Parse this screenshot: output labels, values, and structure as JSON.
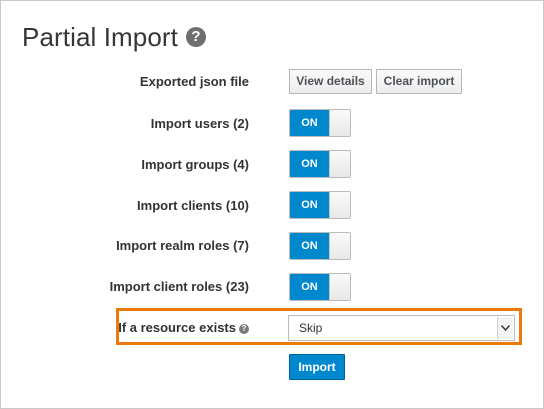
{
  "header": {
    "title": "Partial Import",
    "help_icon": "question-circle-icon",
    "help_glyph": "?"
  },
  "file_row": {
    "label": "Exported json file",
    "view_details_label": "View details",
    "clear_import_label": "Clear import"
  },
  "toggles": [
    {
      "label": "Import users (2)",
      "state": "ON"
    },
    {
      "label": "Import groups (4)",
      "state": "ON"
    },
    {
      "label": "Import clients (10)",
      "state": "ON"
    },
    {
      "label": "Import realm roles (7)",
      "state": "ON"
    },
    {
      "label": "Import client roles (23)",
      "state": "ON"
    }
  ],
  "resource_exists": {
    "label": "If a resource exists",
    "help_glyph": "?",
    "selected": "Skip"
  },
  "import_button": {
    "label": "Import"
  },
  "colors": {
    "accent": "#0088ce",
    "highlight": "#ec7a08",
    "title": "#363636"
  }
}
